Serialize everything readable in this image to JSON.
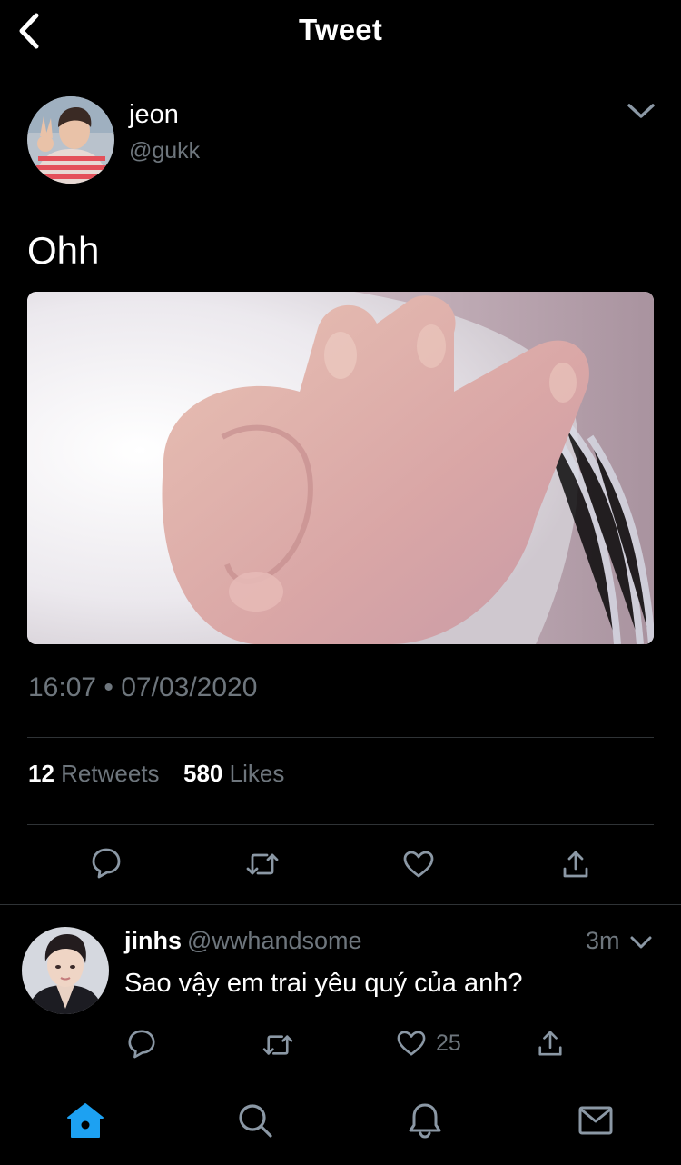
{
  "header": {
    "title": "Tweet",
    "back_icon": "chevron-left-icon"
  },
  "tweet": {
    "author_name": "jeon",
    "author_handle": "@gukk",
    "text": "Ohh",
    "timestamp": "16:07 • 07/03/2020",
    "retweets_count": "12",
    "retweets_label": "Retweets",
    "likes_count": "580",
    "likes_label": "Likes"
  },
  "reply": {
    "name": "jinhs",
    "handle": "@wwhandsome",
    "time": "3m",
    "text": "Sao vậy em trai yêu quý của anh?",
    "like_count": "25"
  },
  "tabbar": {
    "items": [
      "home-icon",
      "search-icon",
      "notifications-icon",
      "messages-icon"
    ],
    "active": "home-icon"
  },
  "colors": {
    "background": "#000000",
    "secondary_text": "#6e767d",
    "divider": "#2f3336",
    "accent": "#1da1f2"
  }
}
